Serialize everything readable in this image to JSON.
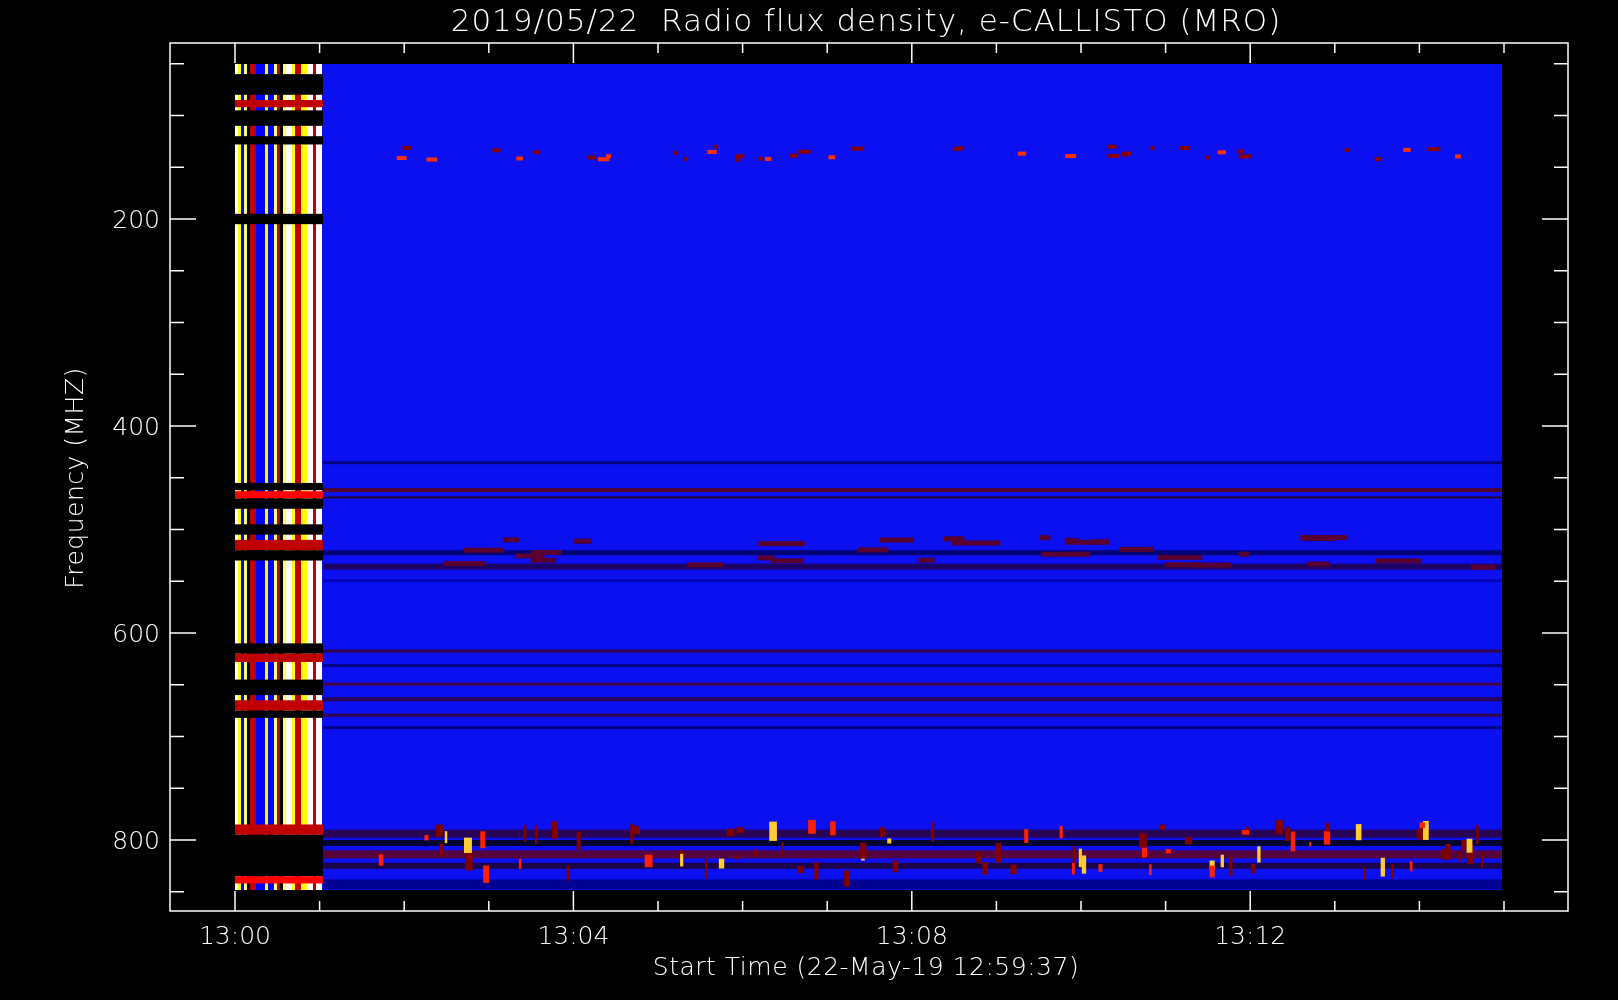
{
  "title": "2019/05/22  Radio flux density, e-CALLISTO (MRO)",
  "y_axis": {
    "label": "Frequency (MHZ)",
    "ticks": [
      "200",
      "400",
      "600",
      "800"
    ]
  },
  "x_axis": {
    "label": "Start Time (22-May-19 12:59:37)",
    "ticks": [
      "13:00",
      "13:04",
      "13:08",
      "13:12"
    ]
  }
}
